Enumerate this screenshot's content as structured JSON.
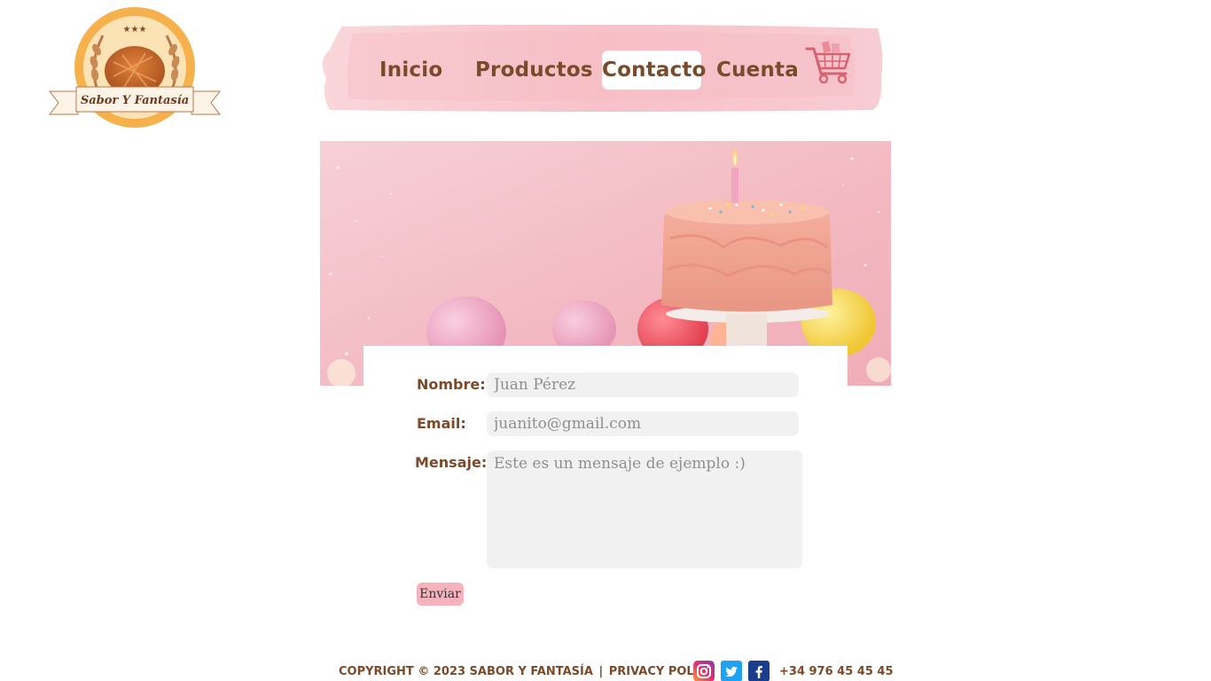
{
  "brand": {
    "name": "Sabor Y Fantasía",
    "stars": "★★★"
  },
  "nav": {
    "items": [
      {
        "label": "Inicio",
        "active": false
      },
      {
        "label": "Productos",
        "active": false
      },
      {
        "label": "Contacto",
        "active": true
      },
      {
        "label": "Cuenta",
        "active": false
      }
    ],
    "cart_icon": "shopping-cart-icon"
  },
  "hero": {
    "image": "pink-birthday-cake-with-candle-and-balloons"
  },
  "form": {
    "name_label": "Nombre:",
    "name_placeholder": "Juan Pérez",
    "email_label": "Email:",
    "email_placeholder": "juanito@gmail.com",
    "message_label": "Mensaje:",
    "message_placeholder": "Este es un mensaje de ejemplo :)",
    "submit_label": "Enviar"
  },
  "footer": {
    "copyright": "COPYRIGHT © 2023 SABOR Y FANTASÍA",
    "separator": "|",
    "privacy": "PRIVACY POLICY",
    "social": [
      "instagram-icon",
      "twitter-icon",
      "facebook-icon"
    ],
    "phone": "+34 976 45 45 45"
  },
  "colors": {
    "brown": "#7a4a2a",
    "pink_button": "#f7b3bd",
    "input_bg": "#f1f1f1",
    "nav_pink": "#f8c9d0"
  }
}
